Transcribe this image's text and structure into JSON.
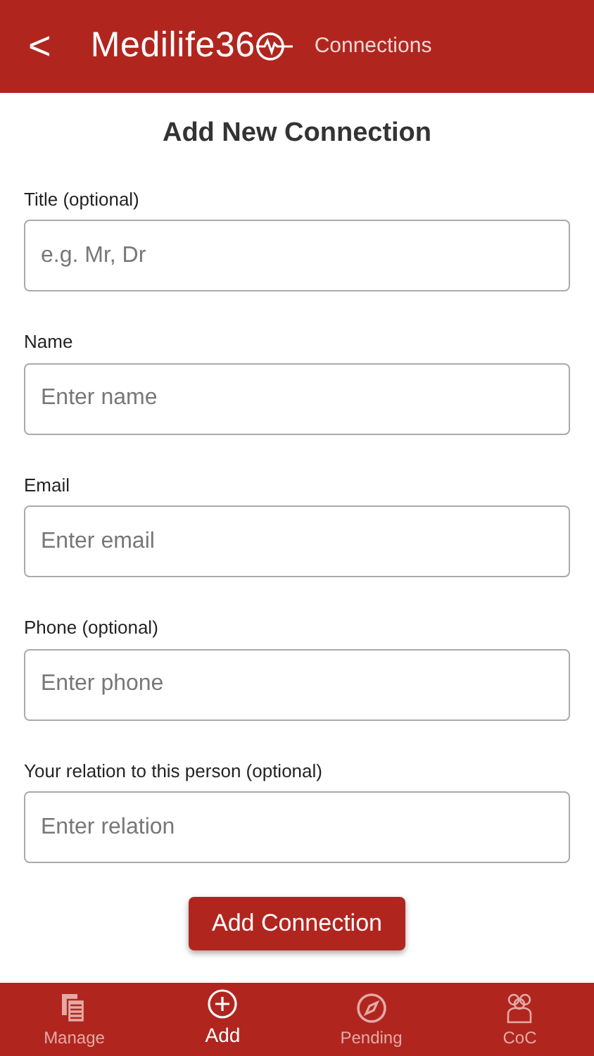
{
  "header": {
    "back": "<",
    "logo": "Medilife36",
    "subtitle": "Connections"
  },
  "title": "Add New Connection",
  "fields": [
    {
      "label": "Title (optional)",
      "placeholder": "e.g. Mr, Dr"
    },
    {
      "label": "Name",
      "placeholder": "Enter name"
    },
    {
      "label": "Email",
      "placeholder": "Enter email"
    },
    {
      "label": "Phone (optional)",
      "placeholder": "Enter phone"
    },
    {
      "label": "Your relation to this person (optional)",
      "placeholder": "Enter relation"
    }
  ],
  "submit": "Add Connection",
  "tabs": [
    {
      "label": "Manage",
      "selected": false
    },
    {
      "label": "Add",
      "selected": true
    },
    {
      "label": "Pending",
      "selected": false
    },
    {
      "label": "CoC",
      "selected": false
    }
  ]
}
